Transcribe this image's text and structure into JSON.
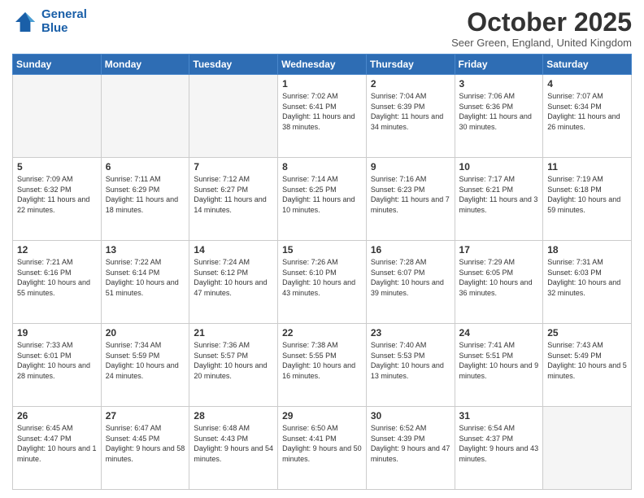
{
  "logo": {
    "line1": "General",
    "line2": "Blue"
  },
  "title": "October 2025",
  "subtitle": "Seer Green, England, United Kingdom",
  "days_of_week": [
    "Sunday",
    "Monday",
    "Tuesday",
    "Wednesday",
    "Thursday",
    "Friday",
    "Saturday"
  ],
  "weeks": [
    [
      {
        "day": "",
        "sunrise": "",
        "sunset": "",
        "daylight": ""
      },
      {
        "day": "",
        "sunrise": "",
        "sunset": "",
        "daylight": ""
      },
      {
        "day": "",
        "sunrise": "",
        "sunset": "",
        "daylight": ""
      },
      {
        "day": "1",
        "sunrise": "Sunrise: 7:02 AM",
        "sunset": "Sunset: 6:41 PM",
        "daylight": "Daylight: 11 hours and 38 minutes."
      },
      {
        "day": "2",
        "sunrise": "Sunrise: 7:04 AM",
        "sunset": "Sunset: 6:39 PM",
        "daylight": "Daylight: 11 hours and 34 minutes."
      },
      {
        "day": "3",
        "sunrise": "Sunrise: 7:06 AM",
        "sunset": "Sunset: 6:36 PM",
        "daylight": "Daylight: 11 hours and 30 minutes."
      },
      {
        "day": "4",
        "sunrise": "Sunrise: 7:07 AM",
        "sunset": "Sunset: 6:34 PM",
        "daylight": "Daylight: 11 hours and 26 minutes."
      }
    ],
    [
      {
        "day": "5",
        "sunrise": "Sunrise: 7:09 AM",
        "sunset": "Sunset: 6:32 PM",
        "daylight": "Daylight: 11 hours and 22 minutes."
      },
      {
        "day": "6",
        "sunrise": "Sunrise: 7:11 AM",
        "sunset": "Sunset: 6:29 PM",
        "daylight": "Daylight: 11 hours and 18 minutes."
      },
      {
        "day": "7",
        "sunrise": "Sunrise: 7:12 AM",
        "sunset": "Sunset: 6:27 PM",
        "daylight": "Daylight: 11 hours and 14 minutes."
      },
      {
        "day": "8",
        "sunrise": "Sunrise: 7:14 AM",
        "sunset": "Sunset: 6:25 PM",
        "daylight": "Daylight: 11 hours and 10 minutes."
      },
      {
        "day": "9",
        "sunrise": "Sunrise: 7:16 AM",
        "sunset": "Sunset: 6:23 PM",
        "daylight": "Daylight: 11 hours and 7 minutes."
      },
      {
        "day": "10",
        "sunrise": "Sunrise: 7:17 AM",
        "sunset": "Sunset: 6:21 PM",
        "daylight": "Daylight: 11 hours and 3 minutes."
      },
      {
        "day": "11",
        "sunrise": "Sunrise: 7:19 AM",
        "sunset": "Sunset: 6:18 PM",
        "daylight": "Daylight: 10 hours and 59 minutes."
      }
    ],
    [
      {
        "day": "12",
        "sunrise": "Sunrise: 7:21 AM",
        "sunset": "Sunset: 6:16 PM",
        "daylight": "Daylight: 10 hours and 55 minutes."
      },
      {
        "day": "13",
        "sunrise": "Sunrise: 7:22 AM",
        "sunset": "Sunset: 6:14 PM",
        "daylight": "Daylight: 10 hours and 51 minutes."
      },
      {
        "day": "14",
        "sunrise": "Sunrise: 7:24 AM",
        "sunset": "Sunset: 6:12 PM",
        "daylight": "Daylight: 10 hours and 47 minutes."
      },
      {
        "day": "15",
        "sunrise": "Sunrise: 7:26 AM",
        "sunset": "Sunset: 6:10 PM",
        "daylight": "Daylight: 10 hours and 43 minutes."
      },
      {
        "day": "16",
        "sunrise": "Sunrise: 7:28 AM",
        "sunset": "Sunset: 6:07 PM",
        "daylight": "Daylight: 10 hours and 39 minutes."
      },
      {
        "day": "17",
        "sunrise": "Sunrise: 7:29 AM",
        "sunset": "Sunset: 6:05 PM",
        "daylight": "Daylight: 10 hours and 36 minutes."
      },
      {
        "day": "18",
        "sunrise": "Sunrise: 7:31 AM",
        "sunset": "Sunset: 6:03 PM",
        "daylight": "Daylight: 10 hours and 32 minutes."
      }
    ],
    [
      {
        "day": "19",
        "sunrise": "Sunrise: 7:33 AM",
        "sunset": "Sunset: 6:01 PM",
        "daylight": "Daylight: 10 hours and 28 minutes."
      },
      {
        "day": "20",
        "sunrise": "Sunrise: 7:34 AM",
        "sunset": "Sunset: 5:59 PM",
        "daylight": "Daylight: 10 hours and 24 minutes."
      },
      {
        "day": "21",
        "sunrise": "Sunrise: 7:36 AM",
        "sunset": "Sunset: 5:57 PM",
        "daylight": "Daylight: 10 hours and 20 minutes."
      },
      {
        "day": "22",
        "sunrise": "Sunrise: 7:38 AM",
        "sunset": "Sunset: 5:55 PM",
        "daylight": "Daylight: 10 hours and 16 minutes."
      },
      {
        "day": "23",
        "sunrise": "Sunrise: 7:40 AM",
        "sunset": "Sunset: 5:53 PM",
        "daylight": "Daylight: 10 hours and 13 minutes."
      },
      {
        "day": "24",
        "sunrise": "Sunrise: 7:41 AM",
        "sunset": "Sunset: 5:51 PM",
        "daylight": "Daylight: 10 hours and 9 minutes."
      },
      {
        "day": "25",
        "sunrise": "Sunrise: 7:43 AM",
        "sunset": "Sunset: 5:49 PM",
        "daylight": "Daylight: 10 hours and 5 minutes."
      }
    ],
    [
      {
        "day": "26",
        "sunrise": "Sunrise: 6:45 AM",
        "sunset": "Sunset: 4:47 PM",
        "daylight": "Daylight: 10 hours and 1 minute."
      },
      {
        "day": "27",
        "sunrise": "Sunrise: 6:47 AM",
        "sunset": "Sunset: 4:45 PM",
        "daylight": "Daylight: 9 hours and 58 minutes."
      },
      {
        "day": "28",
        "sunrise": "Sunrise: 6:48 AM",
        "sunset": "Sunset: 4:43 PM",
        "daylight": "Daylight: 9 hours and 54 minutes."
      },
      {
        "day": "29",
        "sunrise": "Sunrise: 6:50 AM",
        "sunset": "Sunset: 4:41 PM",
        "daylight": "Daylight: 9 hours and 50 minutes."
      },
      {
        "day": "30",
        "sunrise": "Sunrise: 6:52 AM",
        "sunset": "Sunset: 4:39 PM",
        "daylight": "Daylight: 9 hours and 47 minutes."
      },
      {
        "day": "31",
        "sunrise": "Sunrise: 6:54 AM",
        "sunset": "Sunset: 4:37 PM",
        "daylight": "Daylight: 9 hours and 43 minutes."
      },
      {
        "day": "",
        "sunrise": "",
        "sunset": "",
        "daylight": ""
      }
    ]
  ]
}
